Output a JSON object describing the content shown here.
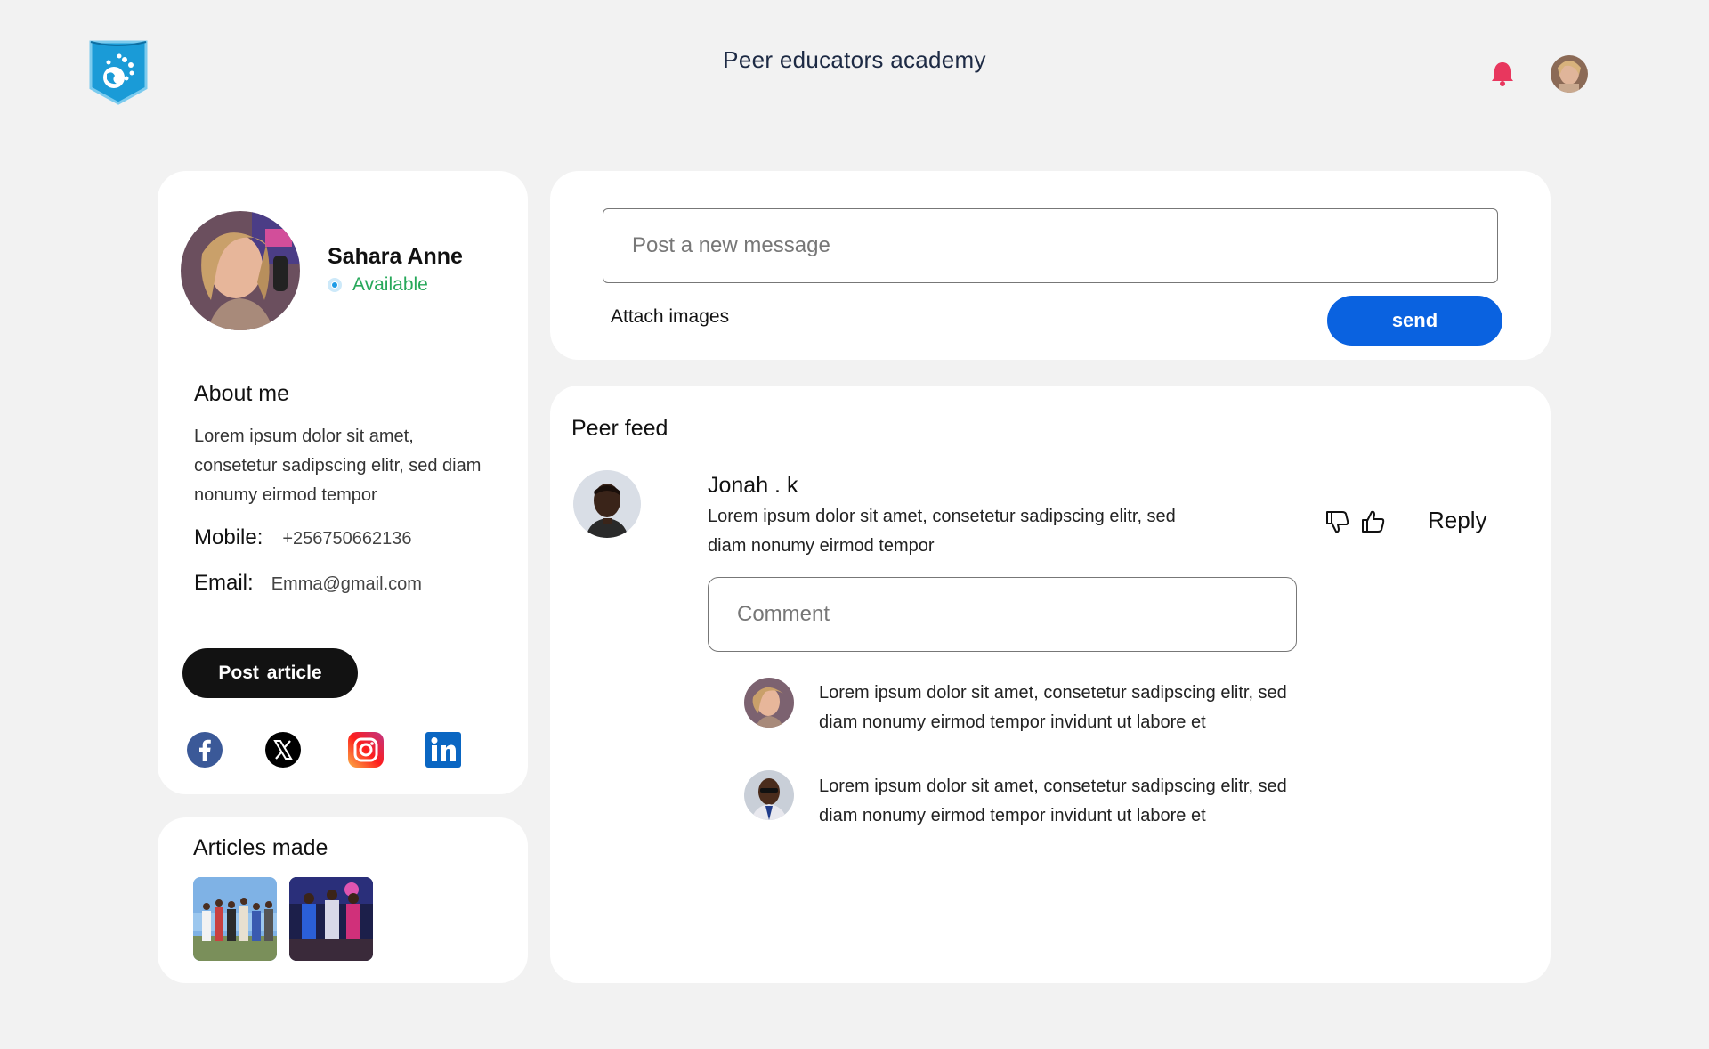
{
  "header": {
    "app_title": "Peer educators academy",
    "logo_icon": "shield-globe-logo",
    "notification_icon": "bell-icon",
    "accent_color": "#e8375e"
  },
  "profile": {
    "name": "Sahara Anne",
    "status": "Available",
    "status_color": "#27a85a",
    "about_title": "About me",
    "about_text": "Lorem ipsum dolor sit amet, consetetur sadipscing elitr, sed diam nonumy eirmod tempor",
    "mobile_label": "Mobile:",
    "mobile_value": "+256750662136",
    "email_label": "Email:",
    "email_value": "Emma@gmail.com",
    "post_article_label": "Post article",
    "social": [
      "facebook-icon",
      "x-icon",
      "instagram-icon",
      "linkedin-icon"
    ]
  },
  "articles": {
    "title": "Articles made"
  },
  "compose": {
    "placeholder": "Post a new message",
    "attach_label": "Attach images",
    "send_label": "send",
    "send_color": "#0a62e0"
  },
  "feed": {
    "title": "Peer feed",
    "post": {
      "author": "Jonah . k",
      "body": "Lorem ipsum dolor sit amet, consetetur sadipscing elitr, sed diam nonumy eirmod tempor",
      "reply_label": "Reply",
      "comment_placeholder": "Comment"
    },
    "replies": [
      {
        "text": "Lorem ipsum dolor sit amet, consetetur sadipscing elitr, sed diam nonumy eirmod tempor invidunt ut labore et"
      },
      {
        "text": "Lorem ipsum dolor sit amet, consetetur sadipscing elitr, sed diam nonumy eirmod tempor invidunt ut labore et"
      }
    ]
  }
}
